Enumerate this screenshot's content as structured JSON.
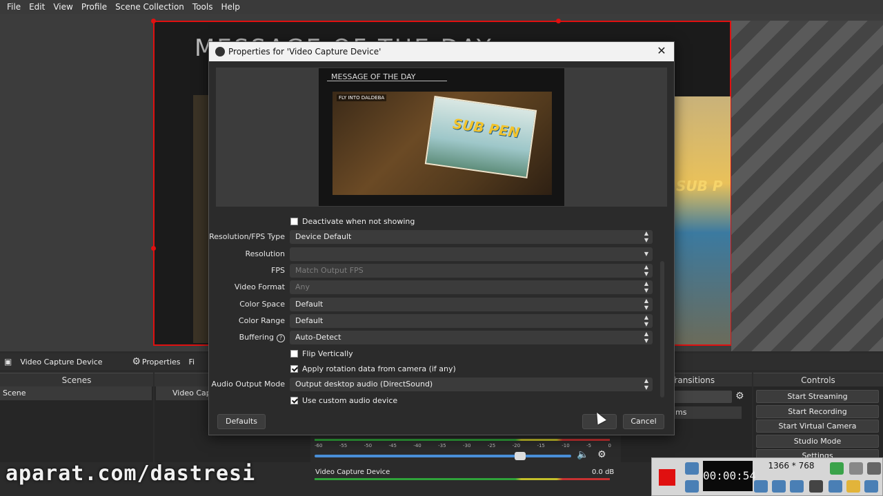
{
  "menubar": {
    "items": [
      "File",
      "Edit",
      "View",
      "Profile",
      "Scene Collection",
      "Tools",
      "Help"
    ]
  },
  "preview": {
    "overlay_title": "MESSAGE OF THE DAY",
    "poster_text": "SUB P"
  },
  "source_toolbar": {
    "source_name": "Video Capture Device",
    "properties_label": "Properties",
    "filters_label": "Fi"
  },
  "docks": {
    "scenes_title": "Scenes",
    "scene_item": "Scene",
    "sources_item": "Video Captu",
    "transitions_title": "Transitions",
    "transition_duration_suffix": "ms",
    "controls_title": "Controls",
    "controls": [
      "Start Streaming",
      "Start Recording",
      "Start Virtual Camera",
      "Studio Mode",
      "Settings"
    ]
  },
  "mixer": {
    "ticks": [
      "-60",
      "-55",
      "-50",
      "-45",
      "-40",
      "-35",
      "-30",
      "-25",
      "-20",
      "-15",
      "-10",
      "-5",
      "0"
    ],
    "channel_name": "Video Capture Device",
    "level": "0.0 dB",
    "volume_fraction": 0.8
  },
  "dialog": {
    "title": "Properties for 'Video Capture Device'",
    "preview": {
      "message_title": "MESSAGE OF THE DAY",
      "card_text": "SUB PEN",
      "label": "FLY INTO DALDEBA"
    },
    "deactivate_label": "Deactivate when not showing",
    "deactivate_checked": false,
    "fields": [
      {
        "label": "Resolution/FPS Type",
        "value": "Device Default",
        "disabled": false
      },
      {
        "label": "Resolution",
        "value": "",
        "disabled": false
      },
      {
        "label": "FPS",
        "value": "Match Output FPS",
        "disabled": true
      },
      {
        "label": "Video Format",
        "value": "Any",
        "disabled": true
      },
      {
        "label": "Color Space",
        "value": "Default",
        "disabled": false
      },
      {
        "label": "Color Range",
        "value": "Default",
        "disabled": false
      },
      {
        "label": "Buffering",
        "value": "Auto-Detect",
        "disabled": false
      }
    ],
    "flip_label": "Flip Vertically",
    "flip_checked": false,
    "rotation_label": "Apply rotation data from camera (if any)",
    "rotation_checked": true,
    "audio_output_label": "Audio Output Mode",
    "audio_output_value": "Output desktop audio (DirectSound)",
    "custom_audio_label": "Use custom audio device",
    "custom_audio_checked": true,
    "defaults_label": "Defaults",
    "ok_label": "",
    "cancel_label": "Cancel"
  },
  "recorder": {
    "timer": "00:00:54",
    "resolution": "1366 * 768"
  },
  "watermark": "aparat.com/dastresi",
  "colors": {
    "selection_red": "#e01010",
    "meter_green": "#2fa33a",
    "slider_blue": "#4a8fd8"
  }
}
